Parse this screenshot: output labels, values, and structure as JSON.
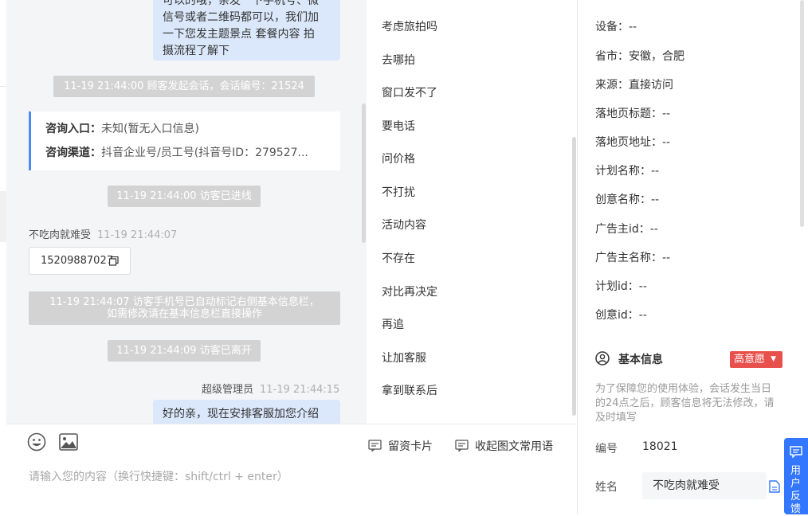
{
  "chat": {
    "top_bubble_lines": [
      "可以的哦，亲发一下手机号、微",
      "信号或者二维码都可以，我们加",
      "一下您发主题景点 套餐内容 拍",
      "摄流程了解下"
    ],
    "sys_session_start": "11-19 21:44:00 顾客发起会话，会话编号：21524",
    "info_card": {
      "entry_label": "咨询入口：",
      "entry_value": "未知(暂无入口信息)",
      "channel_label": "咨询渠道：",
      "channel_value": "抖音企业号/员工号(抖音号ID：279527..."
    },
    "sys_visitor_entered": "11-19 21:44:00 访客已进线",
    "visitor_name": "不吃肉就难受",
    "visitor_time": "11-19 21:44:07",
    "visitor_phone": "15209887027",
    "sys_phone_marked_line1": "11-19 21:44:07 访客手机号已自动标记右侧基本信息栏，",
    "sys_phone_marked_line2": "如需修改请在基本信息栏直接操作",
    "sys_visitor_left": "11-19 21:44:09 访客已离开",
    "agent_name": "超级管理员",
    "agent_time": "11-19 21:44:15",
    "agent_message": "好的亲，现在安排客服加您介绍"
  },
  "input": {
    "emoji_icon": "smile-icon",
    "image_icon": "image-icon",
    "lead_card_label": "留资卡片",
    "collapse_phrases_label": "收起图文常用语",
    "placeholder": "请输入您的内容（换行快捷键：shift/ctrl + enter）"
  },
  "phrases": [
    "考虑旅拍吗",
    "去哪拍",
    "窗口发不了",
    "要电话",
    "问价格",
    "不打扰",
    "活动内容",
    "不存在",
    "对比再决定",
    "再追",
    "让加客服",
    "拿到联系后"
  ],
  "details": [
    {
      "label": "设备：",
      "value": "--"
    },
    {
      "label": "省市：",
      "value": "安徽，合肥"
    },
    {
      "label": "来源：",
      "value": "直接访问"
    },
    {
      "label": "落地页标题：",
      "value": "--"
    },
    {
      "label": "落地页地址：",
      "value": "--"
    },
    {
      "label": "计划名称：",
      "value": "--"
    },
    {
      "label": "创意名称：",
      "value": "--"
    },
    {
      "label": "广告主id：",
      "value": "--"
    },
    {
      "label": "广告主名称：",
      "value": "--"
    },
    {
      "label": "计划id：",
      "value": "--"
    },
    {
      "label": "创意id：",
      "value": "--"
    }
  ],
  "basic_info": {
    "title": "基本信息",
    "intent_badge": "高意愿",
    "note": "为了保障您的使用体验，会话发生当日的24点之后，顾客信息将无法修改，请及时填写",
    "id_label": "编号",
    "id_value": "18021",
    "name_label": "姓名",
    "name_value": "不吃肉就难受"
  },
  "feedback_label": "用户反馈",
  "colors": {
    "accent": "#3377ff",
    "badge": "#e8504c",
    "bubble": "#dbe8fb",
    "system": "#d3d3d3",
    "card_border": "#4c8bf5"
  }
}
